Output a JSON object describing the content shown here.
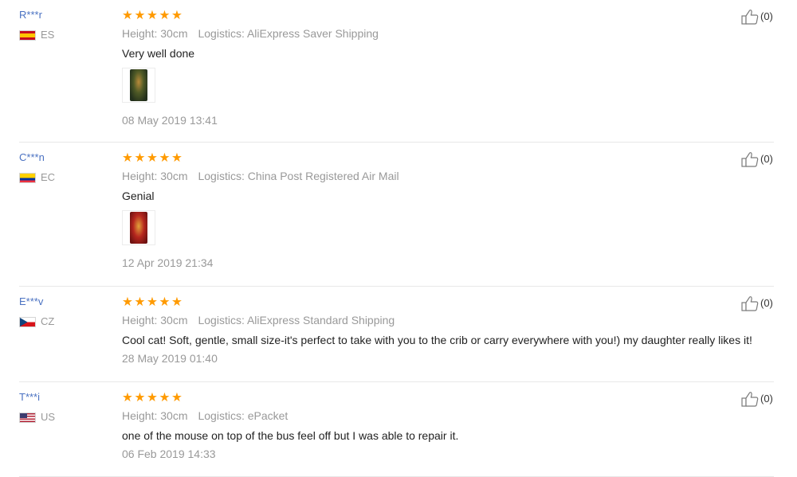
{
  "colors": {
    "username": "#4b72c2",
    "stars": "#ff9a00",
    "meta": "#999999"
  },
  "reviews": [
    {
      "username": "R***r",
      "country": "ES",
      "flag": "spain-flag-icon",
      "stars": [
        "★",
        "★",
        "★",
        "★",
        "★"
      ],
      "rating": 5,
      "height": "Height: 30cm",
      "logistics": "Logistics: AliExpress Saver Shipping",
      "text": "Very well done",
      "photo": "review-photo-thumbnail",
      "date": "08 May 2019 13:41",
      "likes": "(0)"
    },
    {
      "username": "C***n",
      "country": "EC",
      "flag": "ecuador-flag-icon",
      "stars": [
        "★",
        "★",
        "★",
        "★",
        "★"
      ],
      "rating": 5,
      "height": "Height: 30cm",
      "logistics": "Logistics: China Post Registered Air Mail",
      "text": "Genial",
      "photo": "review-photo-thumbnail",
      "date": "12 Apr 2019 21:34",
      "likes": "(0)"
    },
    {
      "username": "E***v",
      "country": "CZ",
      "flag": "czech-flag-icon",
      "stars": [
        "★",
        "★",
        "★",
        "★",
        "★"
      ],
      "rating": 5,
      "height": "Height: 30cm",
      "logistics": "Logistics: AliExpress Standard Shipping",
      "text": "Cool cat! Soft, gentle, small size-it's perfect to take with you to the crib or carry everywhere with you!) my daughter really likes it!",
      "date": "28 May 2019 01:40",
      "likes": "(0)"
    },
    {
      "username": "T***i",
      "country": "US",
      "flag": "usa-flag-icon",
      "stars": [
        "★",
        "★",
        "★",
        "★",
        "★"
      ],
      "rating": 5,
      "height": "Height: 30cm",
      "logistics": "Logistics: ePacket",
      "text": "one of the mouse on top of the bus feel off but I was able to repair it.",
      "date": "06 Feb 2019 14:33",
      "likes": "(0)"
    }
  ]
}
